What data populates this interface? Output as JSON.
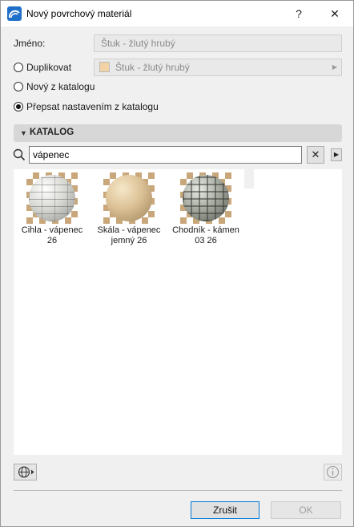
{
  "window": {
    "title": "Nový povrchový materiál",
    "help_label": "?",
    "close_label": "✕"
  },
  "name_row": {
    "label": "Jméno:",
    "value": "Štuk - žlutý hrubý"
  },
  "options": [
    {
      "label": "Duplikovat",
      "selected": false
    },
    {
      "label": "Nový z katalogu",
      "selected": false
    },
    {
      "label": "Přepsat nastavením z katalogu",
      "selected": true
    }
  ],
  "duplicate_select": {
    "value": "Štuk - žlutý hrubý",
    "swatch_color": "#f1d3a5"
  },
  "catalog": {
    "header": "KATALOG",
    "search_value": "vápenec",
    "clear_label": "✕",
    "items": [
      {
        "label_line1": "Cihla - vápenec",
        "label_line2": "26",
        "material": "brick-limestone"
      },
      {
        "label_line1": "Skála - vápenec",
        "label_line2": "jemný 26",
        "material": "rock-limestone-fine"
      },
      {
        "label_line1": "Chodník - kámen",
        "label_line2": "03 26",
        "material": "paving-stone"
      }
    ]
  },
  "footer": {
    "cancel_label": "Zrušit",
    "ok_label": "OK"
  },
  "colors": {
    "accent": "#1e6fc9",
    "checker": "#c9a77a"
  }
}
